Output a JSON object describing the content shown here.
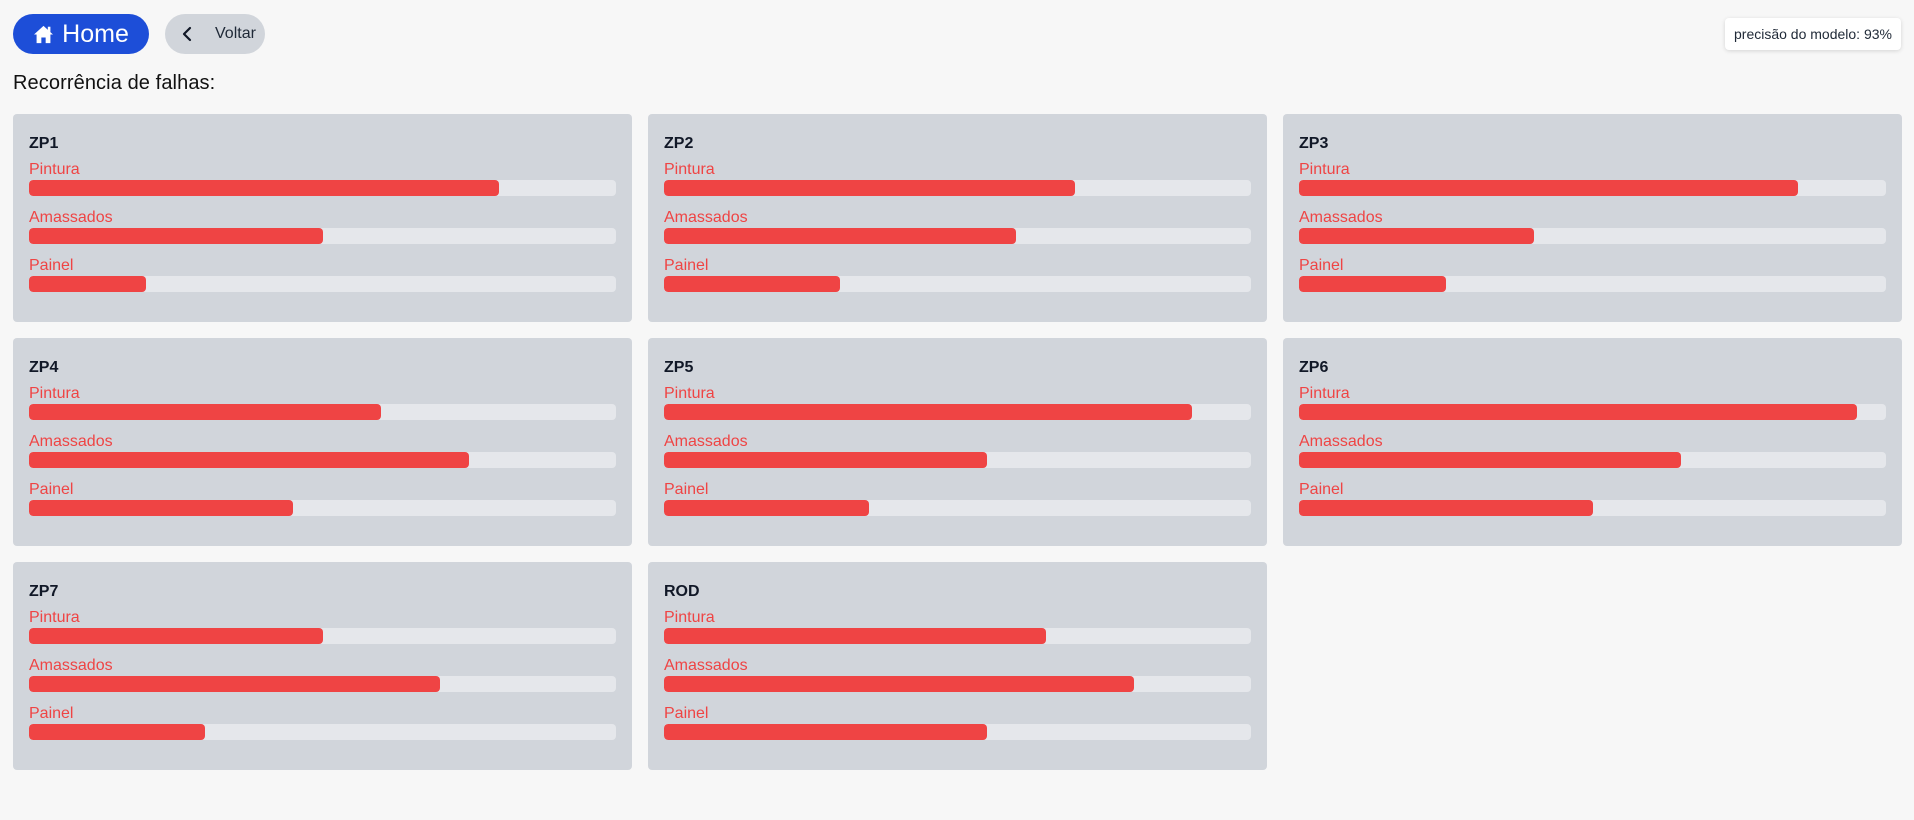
{
  "header": {
    "home_label": "Home",
    "back_label": "Voltar",
    "precision_text": "precisão do modelo: 93%"
  },
  "section_title": "Recorrência de falhas:",
  "colors": {
    "primary": "#1d4ed8",
    "bar_fill": "#ef4444",
    "bar_track": "#e5e7eb",
    "card_bg": "#d1d5db"
  },
  "icons": {
    "home": "home-icon",
    "back": "chevron-left-icon"
  },
  "cards": [
    {
      "title": "ZP1",
      "metrics": [
        {
          "label": "Pintura",
          "value": 0.8
        },
        {
          "label": "Amassados",
          "value": 0.5
        },
        {
          "label": "Painel",
          "value": 0.2
        }
      ]
    },
    {
      "title": "ZP2",
      "metrics": [
        {
          "label": "Pintura",
          "value": 0.7
        },
        {
          "label": "Amassados",
          "value": 0.6
        },
        {
          "label": "Painel",
          "value": 0.3
        }
      ]
    },
    {
      "title": "ZP3",
      "metrics": [
        {
          "label": "Pintura",
          "value": 0.85
        },
        {
          "label": "Amassados",
          "value": 0.4
        },
        {
          "label": "Painel",
          "value": 0.25
        }
      ]
    },
    {
      "title": "ZP4",
      "metrics": [
        {
          "label": "Pintura",
          "value": 0.6
        },
        {
          "label": "Amassados",
          "value": 0.75
        },
        {
          "label": "Painel",
          "value": 0.45
        }
      ]
    },
    {
      "title": "ZP5",
      "metrics": [
        {
          "label": "Pintura",
          "value": 0.9
        },
        {
          "label": "Amassados",
          "value": 0.55
        },
        {
          "label": "Painel",
          "value": 0.35
        }
      ]
    },
    {
      "title": "ZP6",
      "metrics": [
        {
          "label": "Pintura",
          "value": 0.95
        },
        {
          "label": "Amassados",
          "value": 0.65
        },
        {
          "label": "Painel",
          "value": 0.5
        }
      ]
    },
    {
      "title": "ZP7",
      "metrics": [
        {
          "label": "Pintura",
          "value": 0.5
        },
        {
          "label": "Amassados",
          "value": 0.7
        },
        {
          "label": "Painel",
          "value": 0.3
        }
      ]
    },
    {
      "title": "ROD",
      "metrics": [
        {
          "label": "Pintura",
          "value": 0.65
        },
        {
          "label": "Amassados",
          "value": 0.8
        },
        {
          "label": "Painel",
          "value": 0.55
        }
      ]
    }
  ]
}
